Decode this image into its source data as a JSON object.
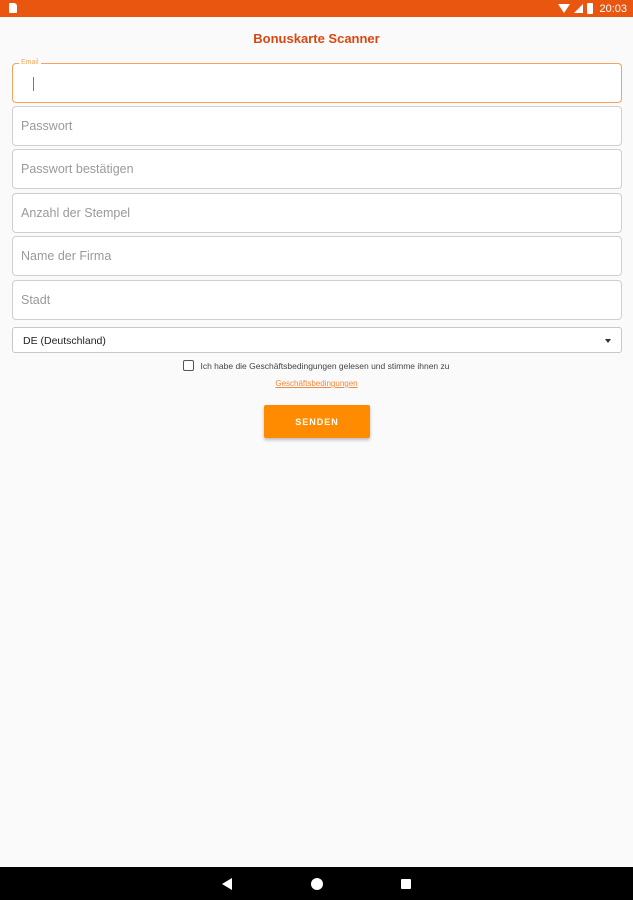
{
  "status_bar": {
    "time": "20:03",
    "icons": [
      "sd-card-icon",
      "wifi-icon",
      "signal-icon",
      "battery-icon"
    ],
    "color": "#e8560f"
  },
  "app": {
    "title": "Bonuskarte Scanner",
    "accent_color": "#ff8c00"
  },
  "form": {
    "email": {
      "label": "Email",
      "value": ""
    },
    "password": {
      "placeholder": "Passwort"
    },
    "password_confirm": {
      "placeholder": "Passwort bestätigen"
    },
    "stamp_count": {
      "placeholder": "Anzahl der Stempel"
    },
    "company_name": {
      "placeholder": "Name der Firma"
    },
    "city": {
      "placeholder": "Stadt"
    },
    "country": {
      "selected": "DE (Deutschland)"
    },
    "terms_checkbox": {
      "label": "Ich habe die Geschäftsbedingungen gelesen und stimme ihnen zu",
      "checked": false
    },
    "terms_link": "Geschäftsbedingungen",
    "submit_label": "SENDEN"
  },
  "nav_bar": {
    "icons": [
      "back-icon",
      "home-icon",
      "recents-icon"
    ]
  }
}
